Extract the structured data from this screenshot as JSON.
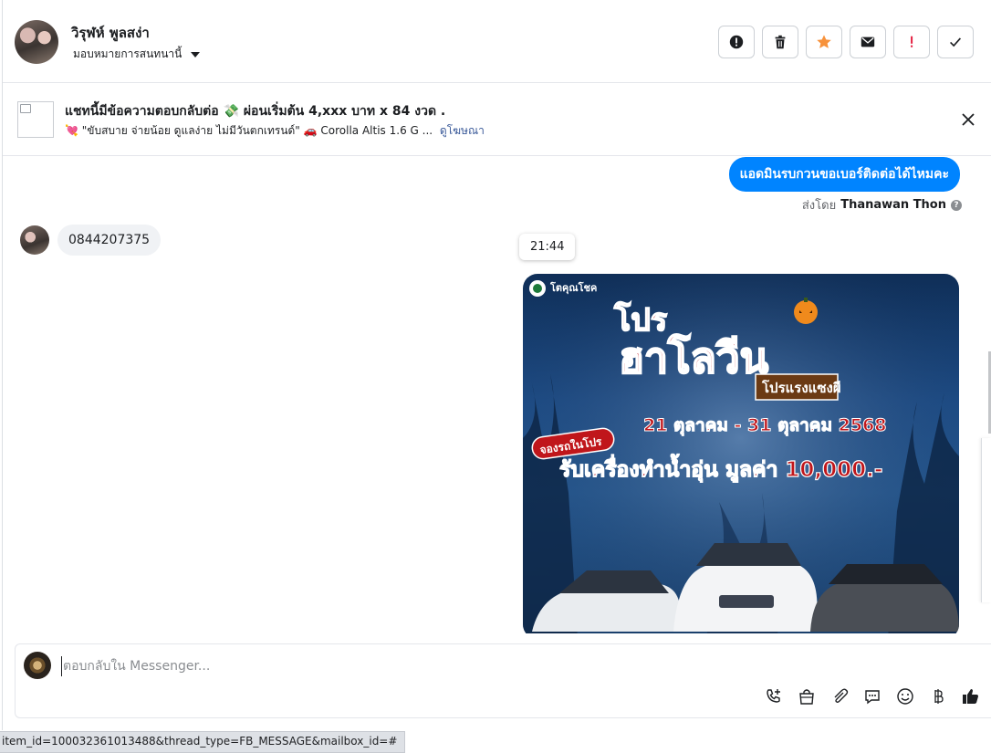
{
  "header": {
    "contact_name": "วิรุฬห์ พูลสง่า",
    "assign_label": "มอบหมายการสนทนานี้",
    "actions": [
      {
        "name": "spam-button",
        "icon": "alert-circle-icon"
      },
      {
        "name": "delete-button",
        "icon": "trash-icon"
      },
      {
        "name": "star-button",
        "icon": "star-icon"
      },
      {
        "name": "mark-unread-button",
        "icon": "envelope-icon"
      },
      {
        "name": "follow-up-button",
        "icon": "exclamation-icon"
      },
      {
        "name": "mark-done-button",
        "icon": "check-icon"
      }
    ]
  },
  "ad": {
    "title": "แชทนี้มีข้อความตอบกลับต่อ 💸 ผ่อนเริ่มต้น 4,xxx บาท x 84 งวด .",
    "description": "💘 \"ขับสบาย จ่ายน้อย ดูแลง่าย ไม่มีวันตกเทรนด์\" 🚗 Corolla Altis 1.6 G ...",
    "link_label": "ดูโฆษณา"
  },
  "messages": {
    "outgoing_text": "แอดมินรบกวนขอเบอร์ติดต่อได้ไหมคะ",
    "sent_by_prefix": "ส่งโดย",
    "sent_by_name": "Thanawan Thon",
    "incoming_text": "0844207375",
    "timestamp": "21:44",
    "promo_image": {
      "brand": "โตคุณโชค",
      "headline_top": "โปร",
      "headline_main": "ฮาโลวีน",
      "tag": "โปรแรงแซงผี",
      "date_range": "21 ตุลาคม - 31 ตุลาคม 2568",
      "badge": "จองรถในโปร",
      "offer": "รับเครื่องทำน้ำอุ่น มูลค่า 10,000.-"
    }
  },
  "composer": {
    "placeholder": "ตอบกลับใน Messenger...",
    "tools": [
      "call-add-icon",
      "shopping-bag-icon",
      "paperclip-icon",
      "saved-reply-icon",
      "emoji-icon",
      "baht-icon",
      "thumbs-up-icon"
    ]
  },
  "statusbar": {
    "url": "item_id=100032361013488&thread_type=FB_MESSAGE&mailbox_id=#"
  },
  "colors": {
    "accent": "#0084ff",
    "star": "#f7923b",
    "danger": "#e41e3f",
    "link": "#385898"
  }
}
